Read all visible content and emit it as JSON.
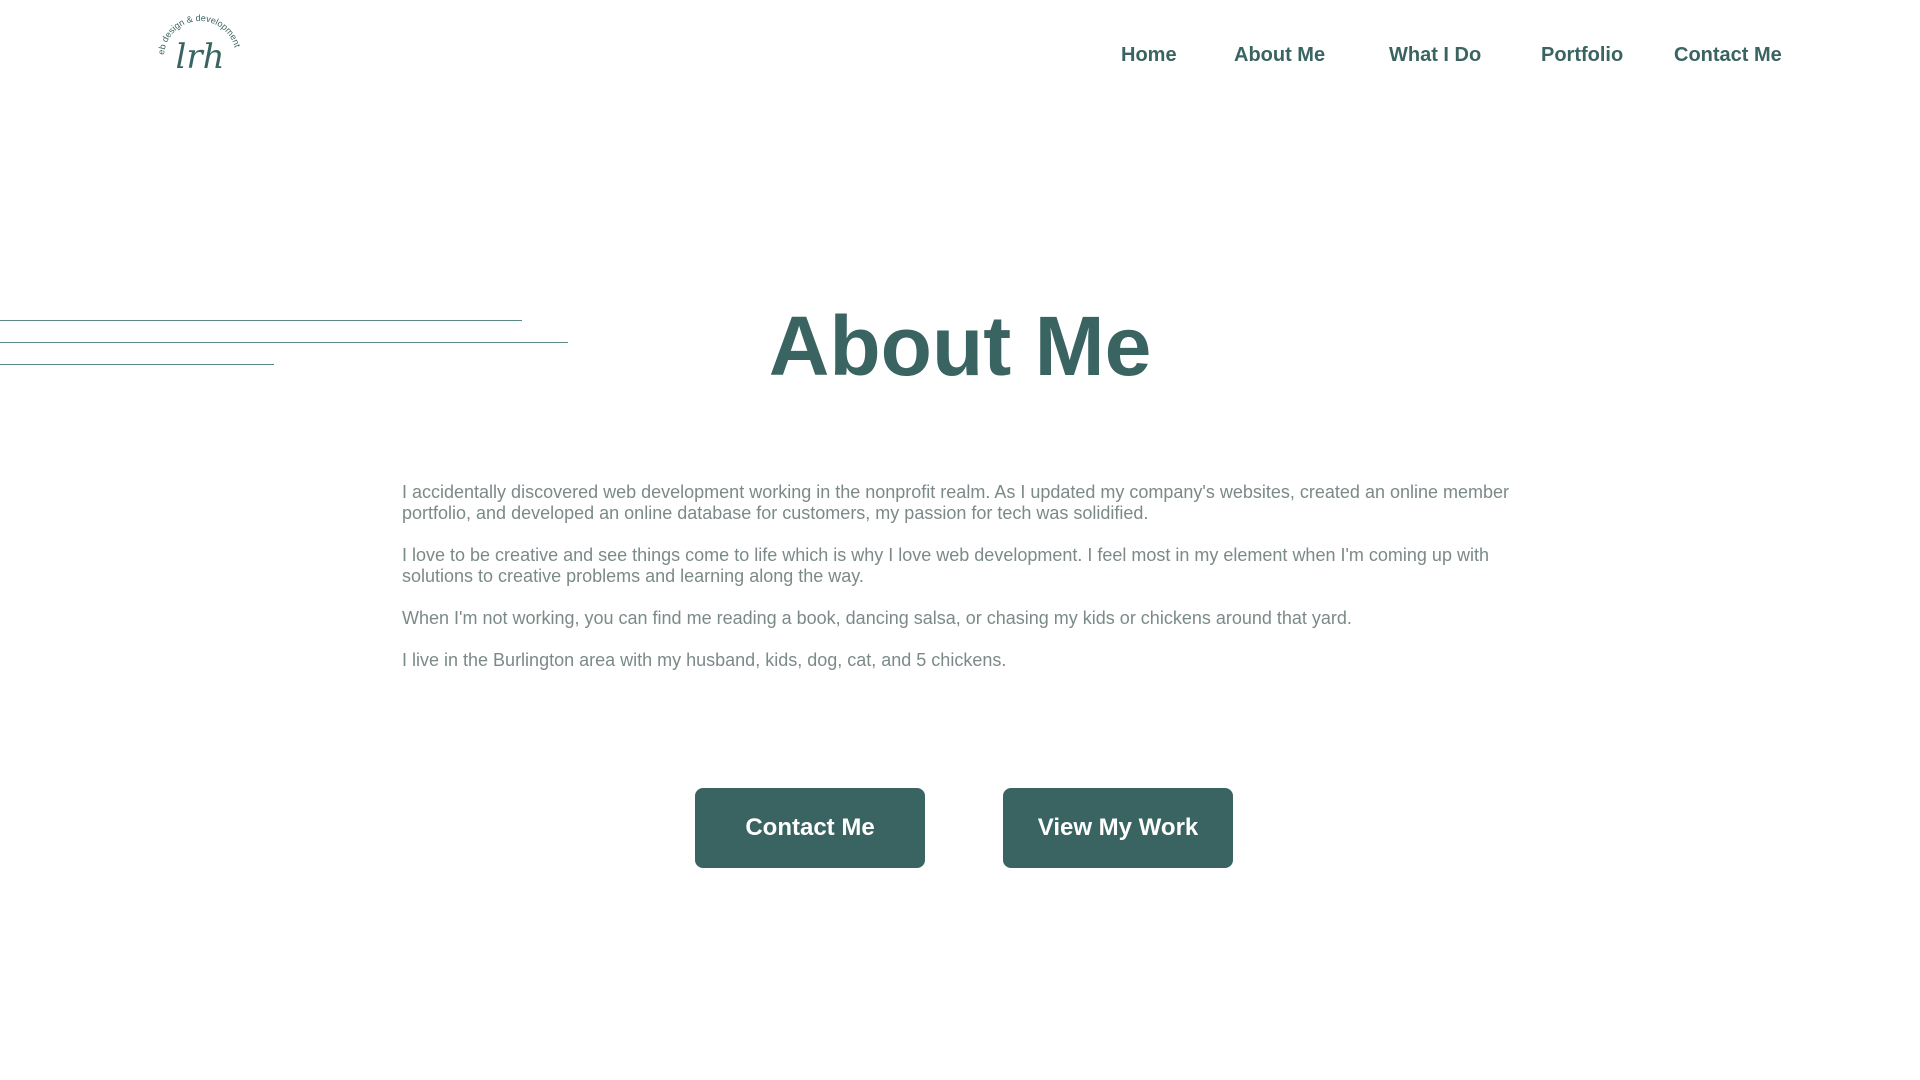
{
  "logo": {
    "monogram": "lrh",
    "ring_text": "web design & development",
    "icon": "lrh-monogram-logo"
  },
  "nav": {
    "items": [
      {
        "label": "Home"
      },
      {
        "label": "About Me"
      },
      {
        "label": "What I Do"
      },
      {
        "label": "Portfolio"
      },
      {
        "label": "Contact Me"
      }
    ]
  },
  "main": {
    "title": "About Me",
    "paragraphs": [
      "I accidentally discovered web development working in the nonprofit realm. As I updated my company's websites, created an online member portfolio, and developed an online database for customers, my passion for tech was solidified.",
      "I love to be creative and see things come to life which is why I love web development. I feel most in my element when I'm coming up with solutions to creative problems and learning along the way.",
      "When I'm not working, you can find me reading a book, dancing salsa, or chasing my kids or chickens around that yard.",
      "I live in the Burlington area with my husband, kids, dog, cat, and 5 chickens."
    ]
  },
  "buttons": {
    "contact_label": "Contact Me",
    "work_label": "View My Work"
  },
  "colors": {
    "accent": "#3a6461",
    "body_text": "#7b8a89",
    "background": "#ffffff",
    "button_text": "#ffffff"
  }
}
